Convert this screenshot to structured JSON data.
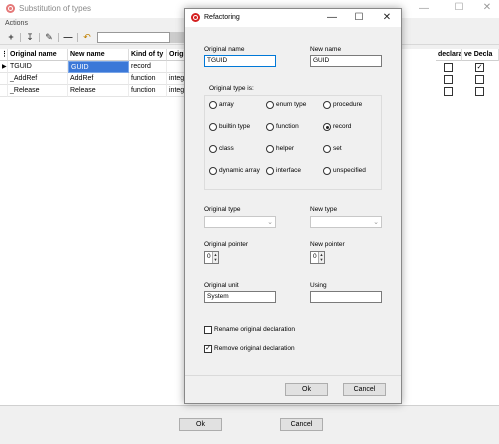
{
  "background": {
    "title": "Substitution of types",
    "actions_label": "Actions",
    "grid": {
      "columns": [
        "Original name",
        "New name",
        "Kind of ty",
        "Origi"
      ],
      "right_columns": [
        "declara",
        "ve Decla"
      ],
      "rows": [
        {
          "original": "TGUID",
          "new": "GUID",
          "kind": "record",
          "orig": "",
          "left_checked": false,
          "right_checked": true
        },
        {
          "original": "_AddRef",
          "new": "AddRef",
          "kind": "function",
          "orig": "intege",
          "left_checked": false,
          "right_checked": false
        },
        {
          "original": "_Release",
          "new": "Release",
          "kind": "function",
          "orig": "intege",
          "left_checked": false,
          "right_checked": false
        }
      ]
    },
    "ok_label": "Ok",
    "cancel_label": "Cancel"
  },
  "dialog": {
    "title": "Refactoring",
    "original_name_label": "Original name",
    "original_name_value": "TGUID",
    "new_name_label": "New name",
    "new_name_value": "GUID",
    "original_type_is_label": "Original type is:",
    "radios": [
      {
        "label": "array",
        "checked": false
      },
      {
        "label": "enum type",
        "checked": false
      },
      {
        "label": "procedure",
        "checked": false
      },
      {
        "label": "builtin type",
        "checked": false
      },
      {
        "label": "function",
        "checked": false
      },
      {
        "label": "record",
        "checked": true
      },
      {
        "label": "class",
        "checked": false
      },
      {
        "label": "helper",
        "checked": false
      },
      {
        "label": "set",
        "checked": false
      },
      {
        "label": "dynamic array",
        "checked": false
      },
      {
        "label": "interface",
        "checked": false
      },
      {
        "label": "unspecified",
        "checked": false
      }
    ],
    "original_type_label": "Original type",
    "original_type_value": "",
    "new_type_label": "New type",
    "new_type_value": "",
    "original_pointer_label": "Original pointer",
    "original_pointer_value": "0",
    "new_pointer_label": "New pointer",
    "new_pointer_value": "0",
    "original_unit_label": "Original unit",
    "original_unit_value": "System",
    "using_label": "Using",
    "using_value": "",
    "rename_label": "Rename original declaration",
    "rename_checked": false,
    "remove_label": "Remove original declaration",
    "remove_checked": true,
    "ok_label": "Ok",
    "cancel_label": "Cancel"
  },
  "colors": {
    "selection": "#3b78d8",
    "focus": "#0078d7",
    "app_icon": "#d42020"
  }
}
